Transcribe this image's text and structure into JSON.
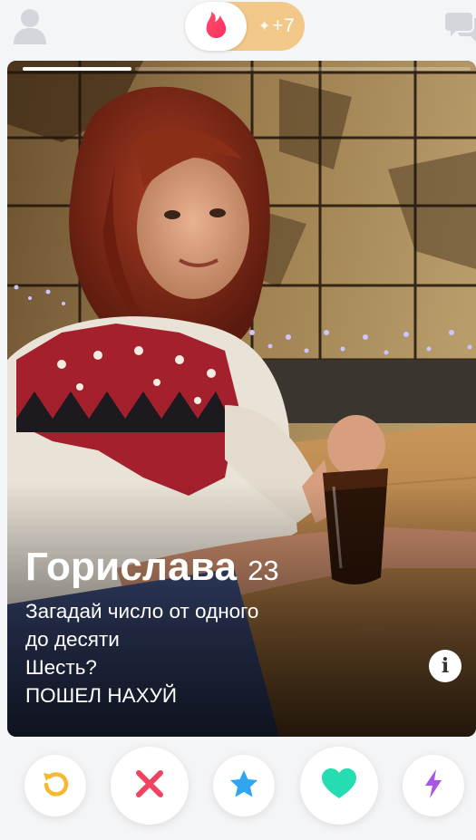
{
  "header": {
    "likes_badge": "+7",
    "profile_icon": "profile-icon",
    "chat_icon": "chat-icon",
    "logo_icon": "flame-icon"
  },
  "card": {
    "name": "Горислава",
    "age": "23",
    "bio_lines": [
      "Загадай число от одного",
      "до десяти",
      "Шесть?",
      "ПОШЕЛ НАХУЙ"
    ],
    "info_label": "i"
  },
  "actions": [
    {
      "name": "rewind",
      "icon": "rewind-icon",
      "color": "#f5b82e"
    },
    {
      "name": "nope",
      "icon": "close-icon",
      "color": "#f0435f"
    },
    {
      "name": "super-like",
      "icon": "star-icon",
      "color": "#2fa6ef"
    },
    {
      "name": "like",
      "icon": "heart-icon",
      "color": "#25ddb0"
    },
    {
      "name": "boost",
      "icon": "lightning-icon",
      "color": "#a855e8"
    }
  ],
  "colors": {
    "brand": "#fd3a73",
    "gold": "#f1c888"
  }
}
